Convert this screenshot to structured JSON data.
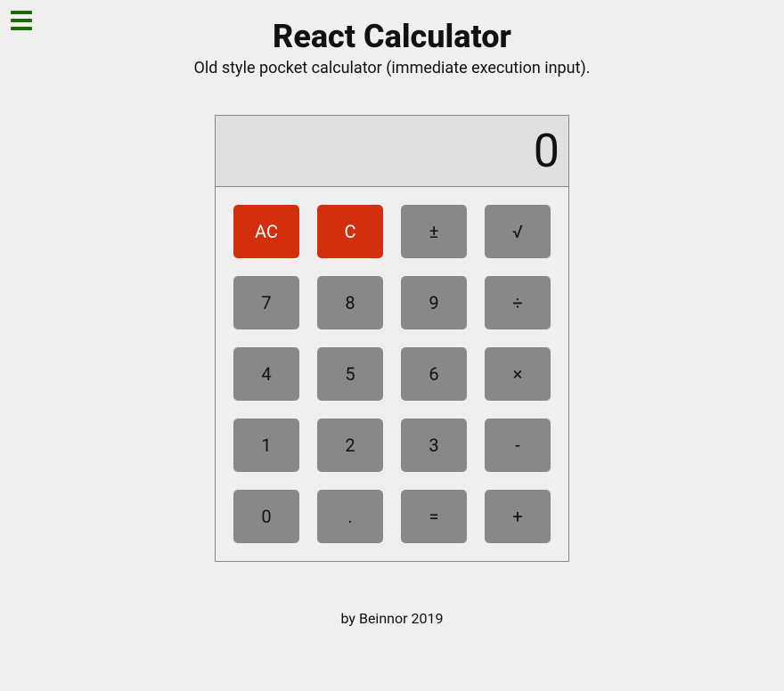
{
  "header": {
    "title": "React Calculator",
    "subtitle": "Old style pocket calculator (immediate execution input)."
  },
  "display": {
    "value": "0"
  },
  "keypad": {
    "rows": [
      [
        {
          "label": "AC",
          "name": "all-clear-button",
          "variant": "red"
        },
        {
          "label": "C",
          "name": "clear-button",
          "variant": "red"
        },
        {
          "label": "±",
          "name": "plus-minus-button",
          "variant": "grey"
        },
        {
          "label": "√",
          "name": "sqrt-button",
          "variant": "grey"
        }
      ],
      [
        {
          "label": "7",
          "name": "digit-7-button",
          "variant": "grey"
        },
        {
          "label": "8",
          "name": "digit-8-button",
          "variant": "grey"
        },
        {
          "label": "9",
          "name": "digit-9-button",
          "variant": "grey"
        },
        {
          "label": "÷",
          "name": "divide-button",
          "variant": "grey"
        }
      ],
      [
        {
          "label": "4",
          "name": "digit-4-button",
          "variant": "grey"
        },
        {
          "label": "5",
          "name": "digit-5-button",
          "variant": "grey"
        },
        {
          "label": "6",
          "name": "digit-6-button",
          "variant": "grey"
        },
        {
          "label": "×",
          "name": "multiply-button",
          "variant": "grey"
        }
      ],
      [
        {
          "label": "1",
          "name": "digit-1-button",
          "variant": "grey"
        },
        {
          "label": "2",
          "name": "digit-2-button",
          "variant": "grey"
        },
        {
          "label": "3",
          "name": "digit-3-button",
          "variant": "grey"
        },
        {
          "label": "-",
          "name": "subtract-button",
          "variant": "grey"
        }
      ],
      [
        {
          "label": "0",
          "name": "digit-0-button",
          "variant": "grey"
        },
        {
          "label": ".",
          "name": "decimal-button",
          "variant": "grey"
        },
        {
          "label": "=",
          "name": "equals-button",
          "variant": "grey"
        },
        {
          "label": "+",
          "name": "add-button",
          "variant": "grey"
        }
      ]
    ]
  },
  "footer": {
    "text": "by Beinnor 2019"
  }
}
